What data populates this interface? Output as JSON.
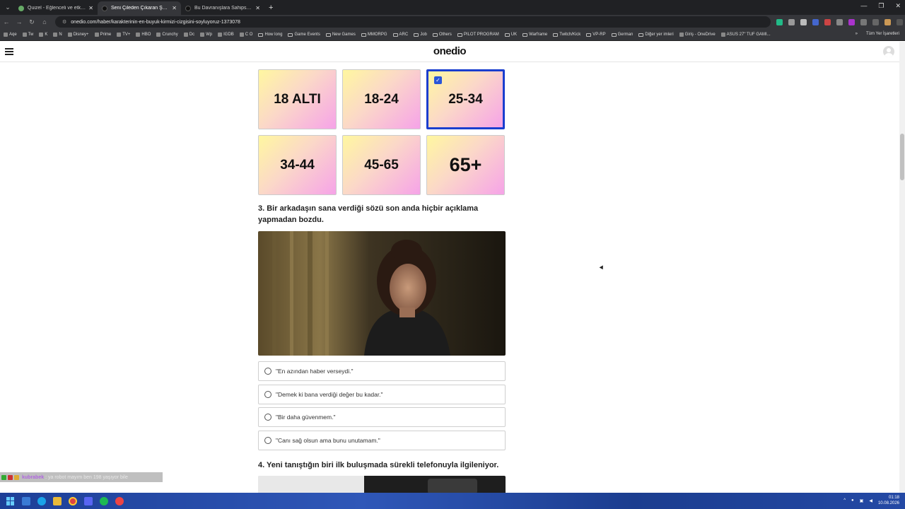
{
  "browser": {
    "tabs": [
      {
        "title": "Quizel - Eğlenceli ve etkileşimli",
        "active": false
      },
      {
        "title": "Seni Çileden Çıkaran Şey Aslında",
        "active": true
      },
      {
        "title": "Bu Davranışlara Sahipsen Kalbin",
        "active": false
      }
    ],
    "url": "onedio.com/haber/karakterinin-en-buyuk-kirmizi-cizgisini-soyluyoruz-1373078",
    "bookmarks": [
      "Aqe",
      "Tw",
      "K",
      "N",
      "Disney+",
      "Prime",
      "TV+",
      "HBO",
      "Crunchy",
      "Dc",
      "Wp",
      "IGDB",
      "C O",
      "How long",
      "Game Events",
      "New Games",
      "MMORPG",
      "ARC",
      "Job",
      "Others",
      "PILOT PROGRAM",
      "UK",
      "Warframe",
      "Twitch/Kick",
      "VP-RP",
      "German",
      "Diğer yer imleri",
      "Giriş - OneDrive",
      "ASUS 27\" TUF GAMI..."
    ],
    "bookmarks_right": "Tüm Yer İşaretleri"
  },
  "site": {
    "logo": "onedio"
  },
  "quiz": {
    "age_options": [
      {
        "label": "18 ALTI",
        "selected": false
      },
      {
        "label": "18-24",
        "selected": false
      },
      {
        "label": "25-34",
        "selected": true
      },
      {
        "label": "34-44",
        "selected": false
      },
      {
        "label": "45-65",
        "selected": false
      },
      {
        "label": "65+",
        "selected": false
      }
    ],
    "q3": {
      "title": "3. Bir arkadaşın sana verdiği sözü son anda hiçbir açıklama yapmadan bozdu.",
      "options": [
        "\"En azından haber verseydi.\"",
        "\"Demek ki bana verdiği değer bu kadar.\"",
        "\"Bir daha güvenmem.\"",
        "\"Canı sağ olsun ama bunu unutamam.\""
      ]
    },
    "q4": {
      "title": "4. Yeni tanıştığın biri ilk buluşmada sürekli telefonuyla ilgileniyor."
    }
  },
  "chat": {
    "user": "kubrabek",
    "message": ": ya robot mayım ben 198 yaşıyor bile"
  },
  "taskbar": {
    "time": "01:18",
    "date": "10.08.2026"
  },
  "colors": {
    "selected_border": "#1a3ecf",
    "check_bg": "#2a56d8",
    "taskbar": "#2449a5"
  }
}
